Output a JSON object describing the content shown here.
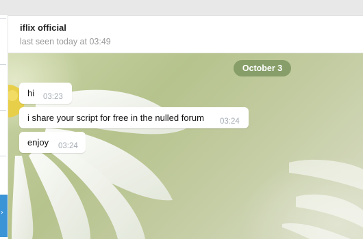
{
  "chat": {
    "name": "iflix official",
    "status": "last seen today at 03:49"
  },
  "date_separator": "October 3",
  "messages": [
    {
      "text": "hi",
      "time": "03:23"
    },
    {
      "text": "i share your script for free in the nulled forum",
      "time": "03:24"
    },
    {
      "text": "enjoy",
      "time": "03:24"
    }
  ],
  "colors": {
    "accent": "#3a94d6",
    "date_pill": "#7e9662",
    "timestamp": "#a3abb3"
  }
}
